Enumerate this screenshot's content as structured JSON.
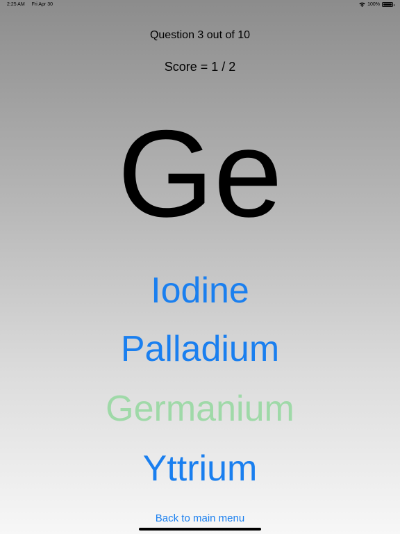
{
  "status_bar": {
    "time": "2:25 AM",
    "date": "Fri Apr 30",
    "battery_text": "100%",
    "battery_level": 1.0
  },
  "quiz": {
    "question_progress": "Question 3 out of 10",
    "score": "Score = 1 / 2",
    "symbol": "Ge",
    "answers": [
      {
        "label": "Iodine",
        "color": "#1a7fef"
      },
      {
        "label": "Palladium",
        "color": "#1a7fef"
      },
      {
        "label": "Germanium",
        "color": "#9fd9a8"
      },
      {
        "label": "Yttrium",
        "color": "#1a7fef"
      }
    ]
  },
  "footer": {
    "back_label": "Back to main menu"
  },
  "icons": [
    "wifi-icon",
    "battery-icon"
  ],
  "colors": {
    "accent": "#1a7fef",
    "correct": "#9fd9a8",
    "text": "#000000"
  }
}
